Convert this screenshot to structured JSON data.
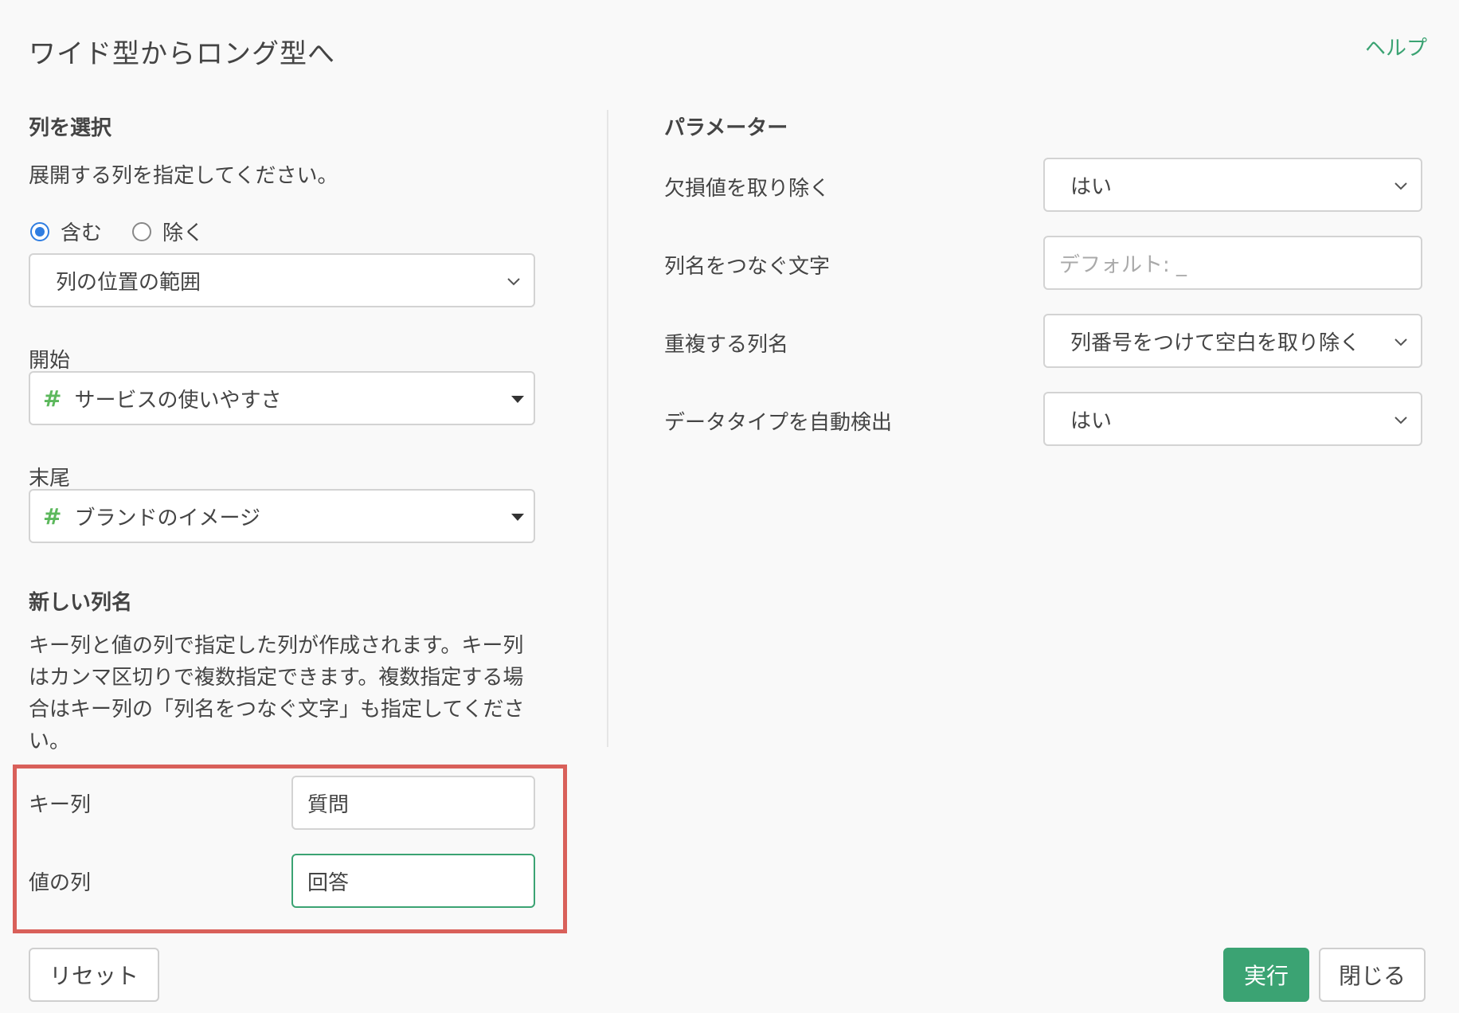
{
  "dialog": {
    "title": "ワイド型からロング型へ",
    "help_label": "ヘルプ"
  },
  "left": {
    "section_title": "列を選択",
    "description": "展開する列を指定してください。",
    "radio": {
      "include_label": "含む",
      "exclude_label": "除く",
      "selected": "include"
    },
    "range_select": {
      "value": "列の位置の範囲"
    },
    "start": {
      "label": "開始",
      "value": "サービスの使いやすさ"
    },
    "end": {
      "label": "末尾",
      "value": "ブランドのイメージ"
    },
    "new_cols": {
      "section_title": "新しい列名",
      "description": "キー列と値の列で指定した列が作成されます。キー列はカンマ区切りで複数指定できます。複数指定する場合はキー列の「列名をつなぐ文字」も指定してください。",
      "key_label": "キー列",
      "key_value": "質問",
      "value_label": "値の列",
      "value_value": "回答"
    }
  },
  "right": {
    "section_title": "パラメーター",
    "params": {
      "drop_na": {
        "label": "欠損値を取り除く",
        "value": "はい"
      },
      "joiner": {
        "label": "列名をつなぐ文字",
        "placeholder": "デフォルト: _"
      },
      "dup_names": {
        "label": "重複する列名",
        "value": "列番号をつけて空白を取り除く"
      },
      "auto_type": {
        "label": "データタイプを自動検出",
        "value": "はい"
      }
    }
  },
  "buttons": {
    "reset": "リセット",
    "run": "実行",
    "close": "閉じる"
  },
  "colors": {
    "accent": "#3ba373",
    "highlight": "#d9605a",
    "radio": "#2f7de1"
  },
  "icons": {
    "hash": "#",
    "chevron": "chevron-down-icon",
    "caret": "caret-down-icon"
  }
}
